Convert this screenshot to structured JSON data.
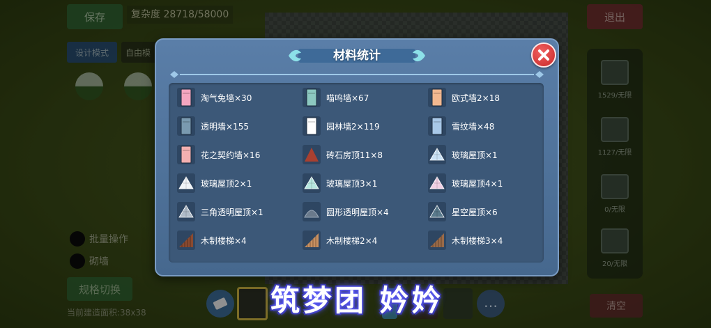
{
  "background": {
    "save_label": "保存",
    "complexity": "复杂度 28718/58000",
    "exit_label": "退出",
    "tab_design": "设计模式",
    "tab_free": "自由模",
    "batch_label": "批量操作",
    "wall_label": "砌墙",
    "switch_label": "规格切换",
    "area_text": "当前建造面积:38x38",
    "right_counts": [
      "1529/无限",
      "1127/无限",
      "0/无限",
      "20/无限"
    ],
    "clear_label": "清空",
    "more_icon": "…"
  },
  "watermark": "筑梦团 妗妗",
  "modal": {
    "title": "材料统计",
    "close_icon": "close-icon",
    "items": [
      {
        "label": "淘气兔墙×30",
        "icon": "wall-pink",
        "color": "#f4a6c0"
      },
      {
        "label": "喵呜墙×67",
        "icon": "wall-teal",
        "color": "#8cc8c0"
      },
      {
        "label": "欧式墙2×18",
        "icon": "wall-peach",
        "color": "#f2b890"
      },
      {
        "label": "透明墙×155",
        "icon": "wall-glass",
        "color": "#7a9ab0"
      },
      {
        "label": "园林墙2×119",
        "icon": "wall-white",
        "color": "#ffffff"
      },
      {
        "label": "雪纹墙×48",
        "icon": "wall-snow",
        "color": "#a8c8e8"
      },
      {
        "label": "花之契约墙×16",
        "icon": "wall-flower",
        "color": "#f4b0b0"
      },
      {
        "label": "砖石房顶11×8",
        "icon": "roof-brick",
        "color": "#a84030"
      },
      {
        "label": "玻璃屋顶×1",
        "icon": "roof-glass",
        "color": "#c8e0f4"
      },
      {
        "label": "玻璃屋顶2×1",
        "icon": "roof-glass-white",
        "color": "#f0f4f8"
      },
      {
        "label": "玻璃屋顶3×1",
        "icon": "roof-glass-teal",
        "color": "#b8e8e0"
      },
      {
        "label": "玻璃屋顶4×1",
        "icon": "roof-glass-pink",
        "color": "#f0d0e4"
      },
      {
        "label": "三角透明屋顶×1",
        "icon": "roof-triangle",
        "color": "#b0bcc8"
      },
      {
        "label": "圆形透明屋顶×4",
        "icon": "roof-round",
        "color": "#6a7a8c"
      },
      {
        "label": "星空屋顶×6",
        "icon": "roof-star",
        "color": "#5a7a8c"
      },
      {
        "label": "木制楼梯×4",
        "icon": "stairs-wood",
        "color": "#8a4a30"
      },
      {
        "label": "木制楼梯2×4",
        "icon": "stairs-wood-2",
        "color": "#c89060"
      },
      {
        "label": "木制楼梯3×4",
        "icon": "stairs-wood-3",
        "color": "#9a6a48"
      }
    ]
  }
}
